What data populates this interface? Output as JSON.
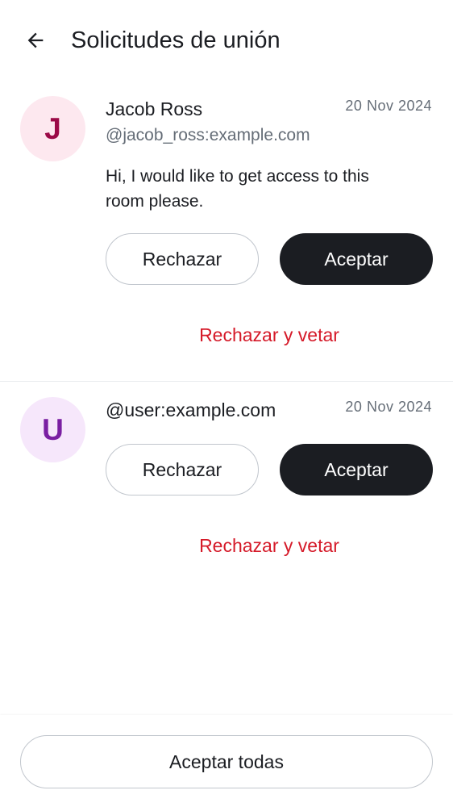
{
  "header": {
    "title": "Solicitudes de unión",
    "back_icon": "arrow-left-icon"
  },
  "requests": [
    {
      "avatar_letter": "J",
      "avatar_bg": "#fde8ef",
      "avatar_fg": "#9b0a47",
      "name": "Jacob Ross",
      "user_id": "@jacob_ross:example.com",
      "date": "20 Nov 2024",
      "message": "Hi, I would like to get access to this room please.",
      "decline_label": "Rechazar",
      "accept_label": "Aceptar",
      "decline_ban_label": "Rechazar y vetar"
    },
    {
      "avatar_letter": "U",
      "avatar_bg": "#f6e7fb",
      "avatar_fg": "#7a1fa2",
      "name": "@user:example.com",
      "date": "20 Nov 2024",
      "decline_label": "Rechazar",
      "accept_label": "Aceptar",
      "decline_ban_label": "Rechazar y vetar"
    }
  ],
  "footer": {
    "accept_all_label": "Aceptar todas"
  },
  "colors": {
    "primary": "#1b1d22",
    "secondary_text": "#656d77",
    "critical": "#d51928",
    "border": "#c1c6cd"
  }
}
